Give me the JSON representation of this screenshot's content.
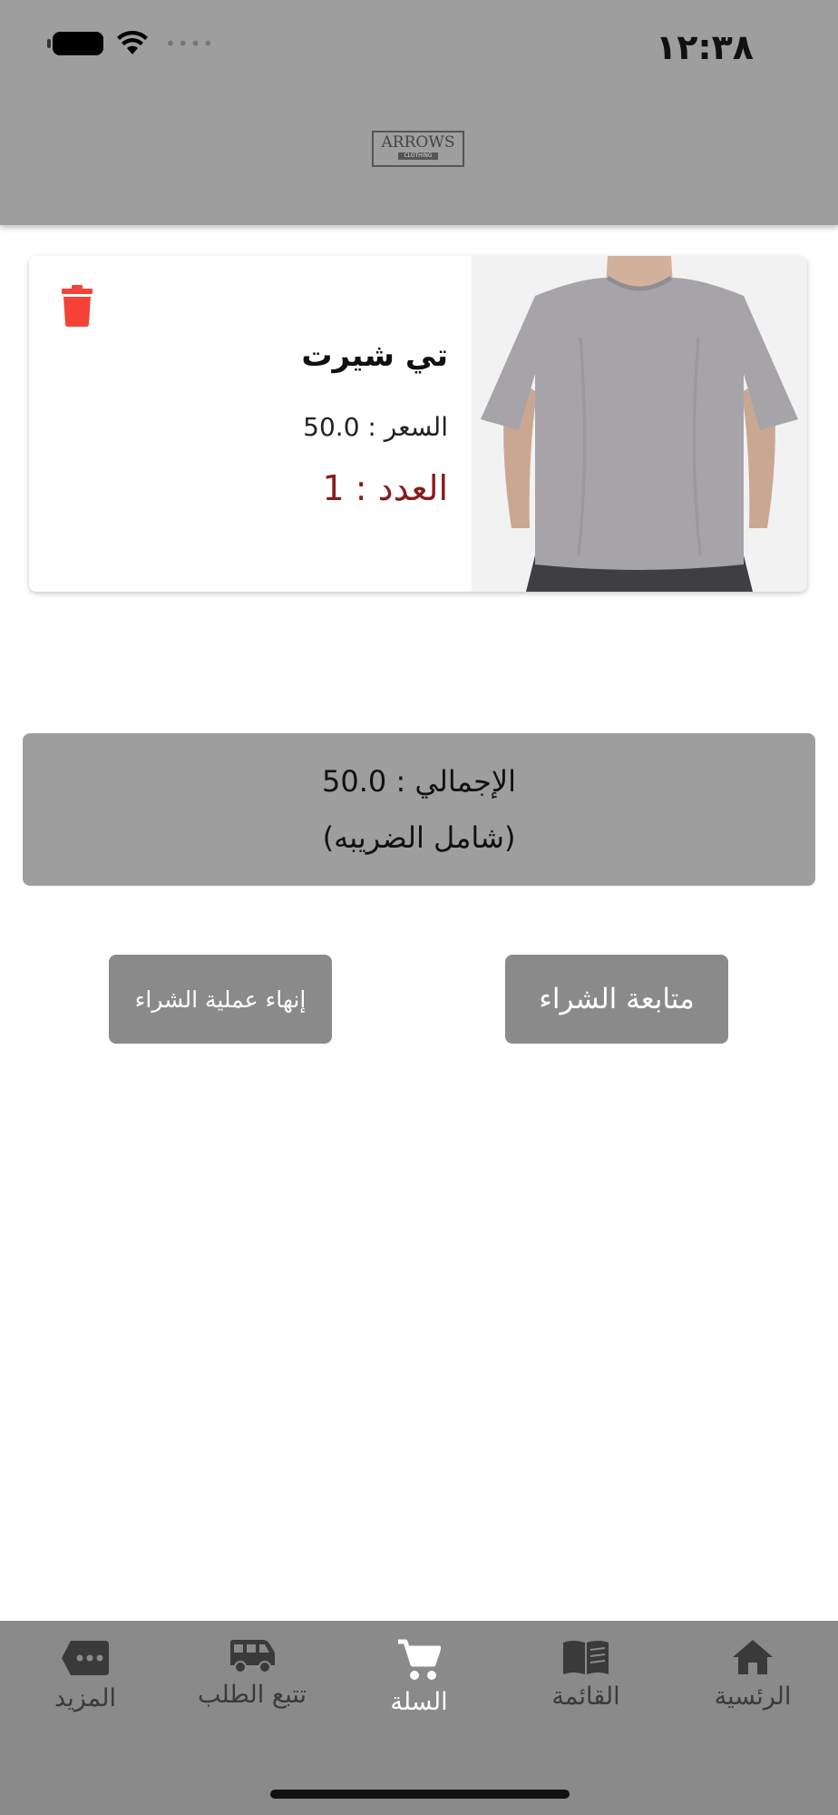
{
  "status_bar": {
    "time": "١٢:٣٨"
  },
  "header": {
    "logo_text": "ARROWS",
    "logo_subtext": "CLOTHING"
  },
  "cart": {
    "items": [
      {
        "title": "تي شيرت",
        "price": "السعر : 50.0",
        "quantity": "العدد : 1",
        "delete_icon": "trash-icon",
        "image": "grey t-shirt photo"
      }
    ]
  },
  "summary": {
    "total": "الإجمالي : 50.0",
    "tax_note": "(شامل الضريبه)"
  },
  "actions": {
    "continue_label": "متابعة الشراء",
    "finish_label": "إنهاء عملية الشراء"
  },
  "tabbar": {
    "items": [
      {
        "label": "الرئسية",
        "icon": "home-icon"
      },
      {
        "label": "القائمة",
        "icon": "book-icon"
      },
      {
        "label": "السلة",
        "icon": "cart-icon",
        "active": true
      },
      {
        "label": "تتبع الطلب",
        "icon": "van-icon"
      },
      {
        "label": "المزيد",
        "icon": "more-icon"
      }
    ]
  },
  "colors": {
    "header_bg": "#9e9e9e",
    "tabbar_bg": "#8a8a8a",
    "button_bg": "#8a8a8a",
    "quantity_text": "#8b1a1a",
    "delete_icon": "#f44336",
    "tab_active": "#ffffff",
    "tab_inactive": "#3a3a3a"
  }
}
